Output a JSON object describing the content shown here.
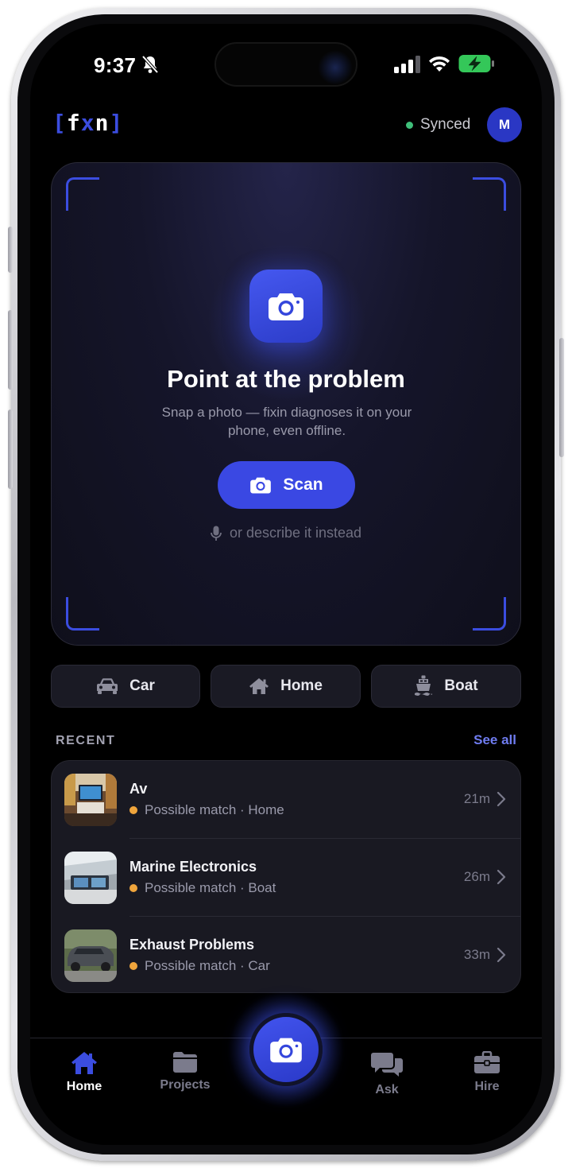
{
  "status_bar": {
    "time": "9:37"
  },
  "header": {
    "logo": "fxn",
    "sync_status": "Synced",
    "avatar_initial": "M"
  },
  "hero": {
    "title": "Point at the problem",
    "subtitle": "Snap a photo — fixin diagnoses it on your phone, even offline.",
    "scan_label": "Scan",
    "describe_label": "or describe it instead"
  },
  "categories": [
    {
      "label": "Car",
      "icon": "car-icon"
    },
    {
      "label": "Home",
      "icon": "house-icon"
    },
    {
      "label": "Boat",
      "icon": "boat-icon"
    }
  ],
  "recent": {
    "heading": "RECENT",
    "see_all": "See all",
    "items": [
      {
        "title": "Av",
        "status": "Possible match",
        "category": "Home",
        "meta": "Possible match · Home",
        "time": "21m",
        "status_color": "#f0a53c"
      },
      {
        "title": "Marine Electronics",
        "status": "Possible match",
        "category": "Boat",
        "meta": "Possible match · Boat",
        "time": "26m",
        "status_color": "#f0a53c"
      },
      {
        "title": "Exhaust Problems",
        "status": "Possible match",
        "category": "Car",
        "meta": "Possible match · Car",
        "time": "33m",
        "status_color": "#f0a53c"
      }
    ]
  },
  "nav": {
    "items": [
      {
        "label": "Home",
        "icon": "house-icon",
        "active": true
      },
      {
        "label": "Projects",
        "icon": "folder-icon",
        "active": false
      },
      {
        "label": "Ask",
        "icon": "chat-bubbles-icon",
        "active": false
      },
      {
        "label": "Hire",
        "icon": "briefcase-icon",
        "active": false
      }
    ],
    "fab_icon": "camera-icon"
  },
  "colors": {
    "accent": "#3b4de0",
    "synced": "#3fbf7a",
    "status_warning": "#f0a53c",
    "background": "#000000"
  }
}
